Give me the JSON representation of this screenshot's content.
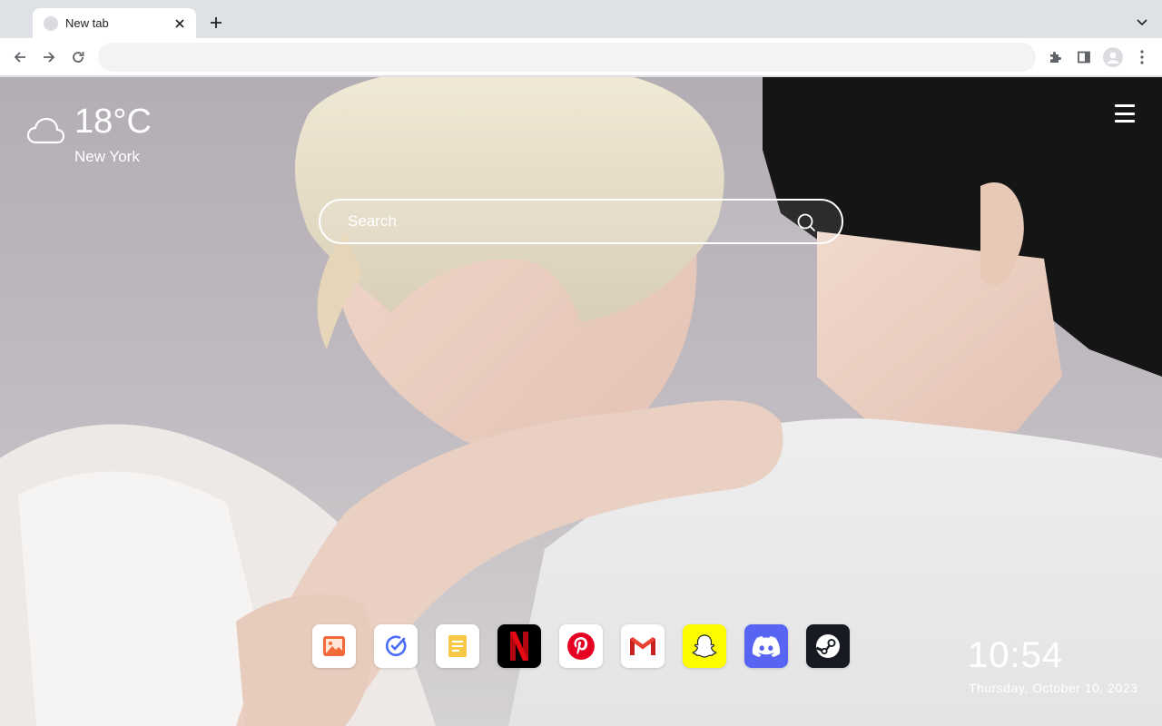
{
  "browser": {
    "tab": {
      "title": "New tab"
    },
    "omnibox": {
      "value": "",
      "placeholder": ""
    },
    "icons": {
      "back": "arrow-left-icon",
      "forward": "arrow-right-icon",
      "reload": "reload-icon",
      "extensions": "puzzle-icon",
      "side_panel": "side-panel-icon",
      "profile": "profile-avatar-icon",
      "menu": "kebab-menu-icon",
      "new_tab": "plus-icon",
      "tab_search": "chevron-down-icon"
    }
  },
  "weather": {
    "temperature": "18°C",
    "city": "New York",
    "icon": "cloud-icon"
  },
  "search": {
    "placeholder": "Search",
    "icon": "search-icon"
  },
  "apps": [
    {
      "name": "Gallery",
      "icon": "gallery-icon",
      "bg": "#ffffff"
    },
    {
      "name": "Tasks",
      "icon": "check-circle-icon",
      "bg": "#ffffff"
    },
    {
      "name": "Notes",
      "icon": "notes-icon",
      "bg": "#ffffff"
    },
    {
      "name": "Netflix",
      "icon": "netflix-icon",
      "bg": "#000000"
    },
    {
      "name": "Pinterest",
      "icon": "pinterest-icon",
      "bg": "#ffffff"
    },
    {
      "name": "Gmail",
      "icon": "gmail-icon",
      "bg": "#ffffff"
    },
    {
      "name": "Snapchat",
      "icon": "snapchat-icon",
      "bg": "#fffc00"
    },
    {
      "name": "Discord",
      "icon": "discord-icon",
      "bg": "#5865f2"
    },
    {
      "name": "Steam",
      "icon": "steam-icon",
      "bg": "#171a21"
    }
  ],
  "clock": {
    "time": "10:54",
    "date": "Thursday, October 10, 2023"
  },
  "colors": {
    "accent_red": "#e60023",
    "netflix_red": "#e50914",
    "discord": "#5865f2",
    "snapchat": "#fffc00"
  }
}
